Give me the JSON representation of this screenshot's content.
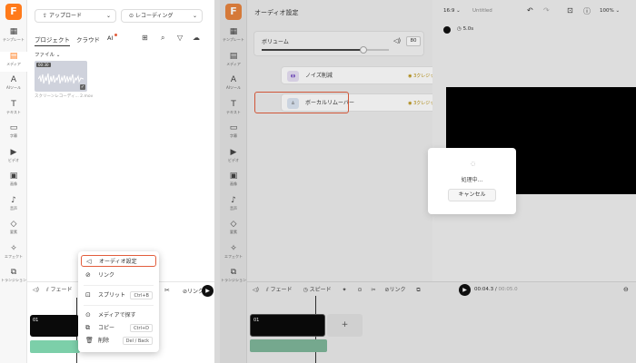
{
  "left": {
    "rail": [
      {
        "icon": "▦",
        "label": "テンプレート"
      },
      {
        "icon": "▤",
        "label": "メディア"
      },
      {
        "icon": "A",
        "label": "AIツール"
      },
      {
        "icon": "T",
        "label": "テキスト"
      },
      {
        "icon": "▭",
        "label": "字幕"
      },
      {
        "icon": "▶",
        "label": "ビデオ"
      },
      {
        "icon": "▣",
        "label": "画像"
      },
      {
        "icon": "♪",
        "label": "音声"
      },
      {
        "icon": "◇",
        "label": "要素"
      },
      {
        "icon": "✧",
        "label": "エフェクト"
      },
      {
        "icon": "⧉",
        "label": "トランジション"
      }
    ],
    "upload_label": "アップロード",
    "record_label": "レコーディング",
    "tabs": [
      "プロジェクト",
      "クラウド",
      "AI"
    ],
    "file_label": "ファイル",
    "clip_duration": "00:30",
    "clip_name": "スクリーンレコーディ... 2.mov",
    "timeline": {
      "fade": "フェード",
      "clip_label": "01",
      "link": "リンク"
    },
    "context_menu": {
      "audio_settings": "オーディオ設定",
      "link": "リンク",
      "split": "スプリット",
      "split_shortcut": "Ctrl+B",
      "locate_media": "メディアで探す",
      "copy": "コピー",
      "copy_shortcut": "Ctrl+D",
      "delete": "削除",
      "delete_shortcut": "Del / Back"
    }
  },
  "right": {
    "rail": [
      {
        "icon": "▦",
        "label": "テンプレート"
      },
      {
        "icon": "▤",
        "label": "メディア"
      },
      {
        "icon": "A",
        "label": "AIツール"
      },
      {
        "icon": "T",
        "label": "テキスト"
      },
      {
        "icon": "▭",
        "label": "字幕"
      },
      {
        "icon": "▶",
        "label": "ビデオ"
      },
      {
        "icon": "▣",
        "label": "画像"
      },
      {
        "icon": "♪",
        "label": "音声"
      },
      {
        "icon": "◇",
        "label": "要素"
      },
      {
        "icon": "✧",
        "label": "エフェクト"
      },
      {
        "icon": "⧉",
        "label": "トランジション"
      }
    ],
    "panel_title": "オーディオ設定",
    "volume_label": "ボリューム",
    "volume_value": "80",
    "volume_fraction": 0.8,
    "noise_reduction": "ノイズ削減",
    "noise_credit": "3クレジット/回",
    "vocal_remover": "ボーカルリムーバー",
    "vocal_credit": "3クレジット/回",
    "aspect": "16:9",
    "project_name": "Untitled",
    "zoom": "100%",
    "duration_chip": "5.0s",
    "dialog_text": "処理中...",
    "cancel_label": "キャンセル",
    "timeline": {
      "fade": "フェード",
      "speed": "スピード",
      "link": "リンク",
      "time": "00:04.3",
      "total": "00:05.0",
      "clip_label": "01"
    }
  },
  "colors": {
    "brand": "#ff7a1a",
    "highlight": "#e25d3c",
    "audio_clip": "#7ccfa9"
  }
}
